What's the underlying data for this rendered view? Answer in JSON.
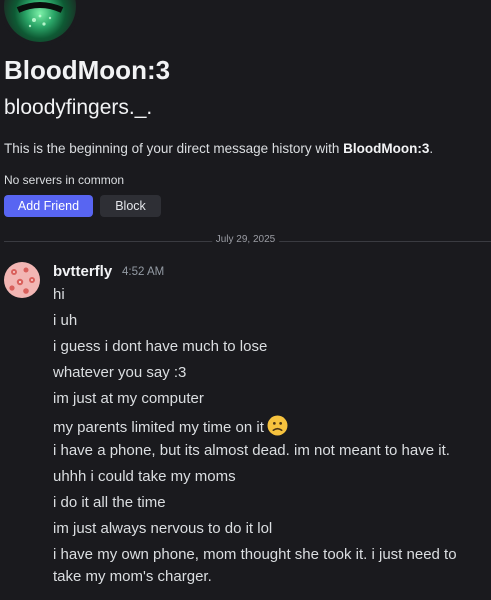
{
  "profile": {
    "display_name": "BloodMoon:3",
    "username": "bloodyfingers._.",
    "history_prefix": "This is the beginning of your direct message history with ",
    "history_name": "BloodMoon:3",
    "history_suffix": ".",
    "servers_text": "No servers in common",
    "add_friend_label": "Add Friend",
    "block_label": "Block"
  },
  "divider": {
    "date": "July 29, 2025"
  },
  "message": {
    "author": "bvtterfly",
    "time": "4:52 AM",
    "lines": [
      "hi",
      "i uh",
      "i guess i dont have much to lose",
      "whatever you say :3",
      "im just at my computer",
      "my parents limited my time on it",
      "i have a phone, but its almost dead. im not meant to have it.",
      "uhhh i could take my moms",
      "i do it all the time",
      "im just always nervous to do it lol",
      "i have my own phone, mom thought she took it. i just need to",
      "take my mom's charger."
    ],
    "emoji": "slightly-frowning-face"
  },
  "colors": {
    "background": "#1a1a1e",
    "accent": "#5865f2",
    "secondary_button": "#2e2f35",
    "muted_text": "#949ba4"
  }
}
